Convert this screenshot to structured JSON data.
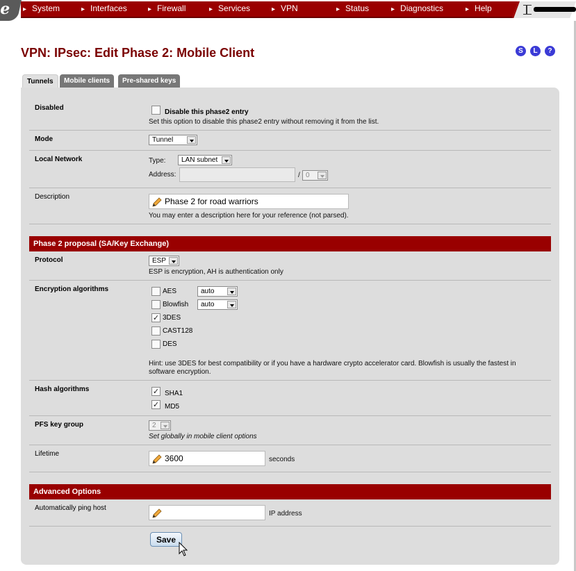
{
  "nav": {
    "items": [
      "System",
      "Interfaces",
      "Firewall",
      "Services",
      "VPN",
      "Status",
      "Diagnostics",
      "Help"
    ]
  },
  "header": {
    "title": "VPN: IPsec: Edit Phase 2: Mobile Client",
    "help_icons": [
      "S",
      "L",
      "?"
    ]
  },
  "tabs": [
    "Tunnels",
    "Mobile clients",
    "Pre-shared keys"
  ],
  "form": {
    "disabled": {
      "label": "Disabled",
      "checkbox_label": "Disable this phase2 entry",
      "help": "Set this option to disable this phase2 entry without removing it from the list.",
      "checked": false
    },
    "mode": {
      "label": "Mode",
      "value": "Tunnel"
    },
    "local_network": {
      "label": "Local Network",
      "type_label": "Type:",
      "type_value": "LAN subnet",
      "address_label": "Address:",
      "address_value": "",
      "mask_separator": "/",
      "mask_value": "0"
    },
    "description": {
      "label": "Description",
      "value": "Phase 2 for road warriors",
      "help": "You may enter a description here for your reference (not parsed)."
    }
  },
  "proposal": {
    "heading": "Phase 2 proposal (SA/Key Exchange)",
    "protocol": {
      "label": "Protocol",
      "value": "ESP",
      "help": "ESP is encryption, AH is authentication only"
    },
    "encryption": {
      "label": "Encryption algorithms",
      "options": [
        {
          "name": "AES",
          "checked": false,
          "keylen": "auto"
        },
        {
          "name": "Blowfish",
          "checked": false,
          "keylen": "auto"
        },
        {
          "name": "3DES",
          "checked": true
        },
        {
          "name": "CAST128",
          "checked": false
        },
        {
          "name": "DES",
          "checked": false
        }
      ],
      "hint_line1": "Hint: use 3DES for best compatibility or if you have a hardware crypto accelerator card. Blowfish is usually the fastest in",
      "hint_line2": "software encryption."
    },
    "hash": {
      "label": "Hash algorithms",
      "options": [
        {
          "name": "SHA1",
          "checked": true
        },
        {
          "name": "MD5",
          "checked": true
        }
      ]
    },
    "pfs": {
      "label": "PFS key group",
      "value": "2",
      "help": "Set globally in mobile client options"
    },
    "lifetime": {
      "label": "Lifetime",
      "value": "3600",
      "unit": "seconds"
    }
  },
  "advanced": {
    "heading": "Advanced Options",
    "ping_host": {
      "label": "Automatically ping host",
      "value": "",
      "unit": "IP address"
    }
  },
  "actions": {
    "save_label": "Save"
  },
  "colors": {
    "brand": "#990000",
    "title": "#7a0000",
    "panel": "#dddddd",
    "icon_blue": "#3b3bd6"
  }
}
